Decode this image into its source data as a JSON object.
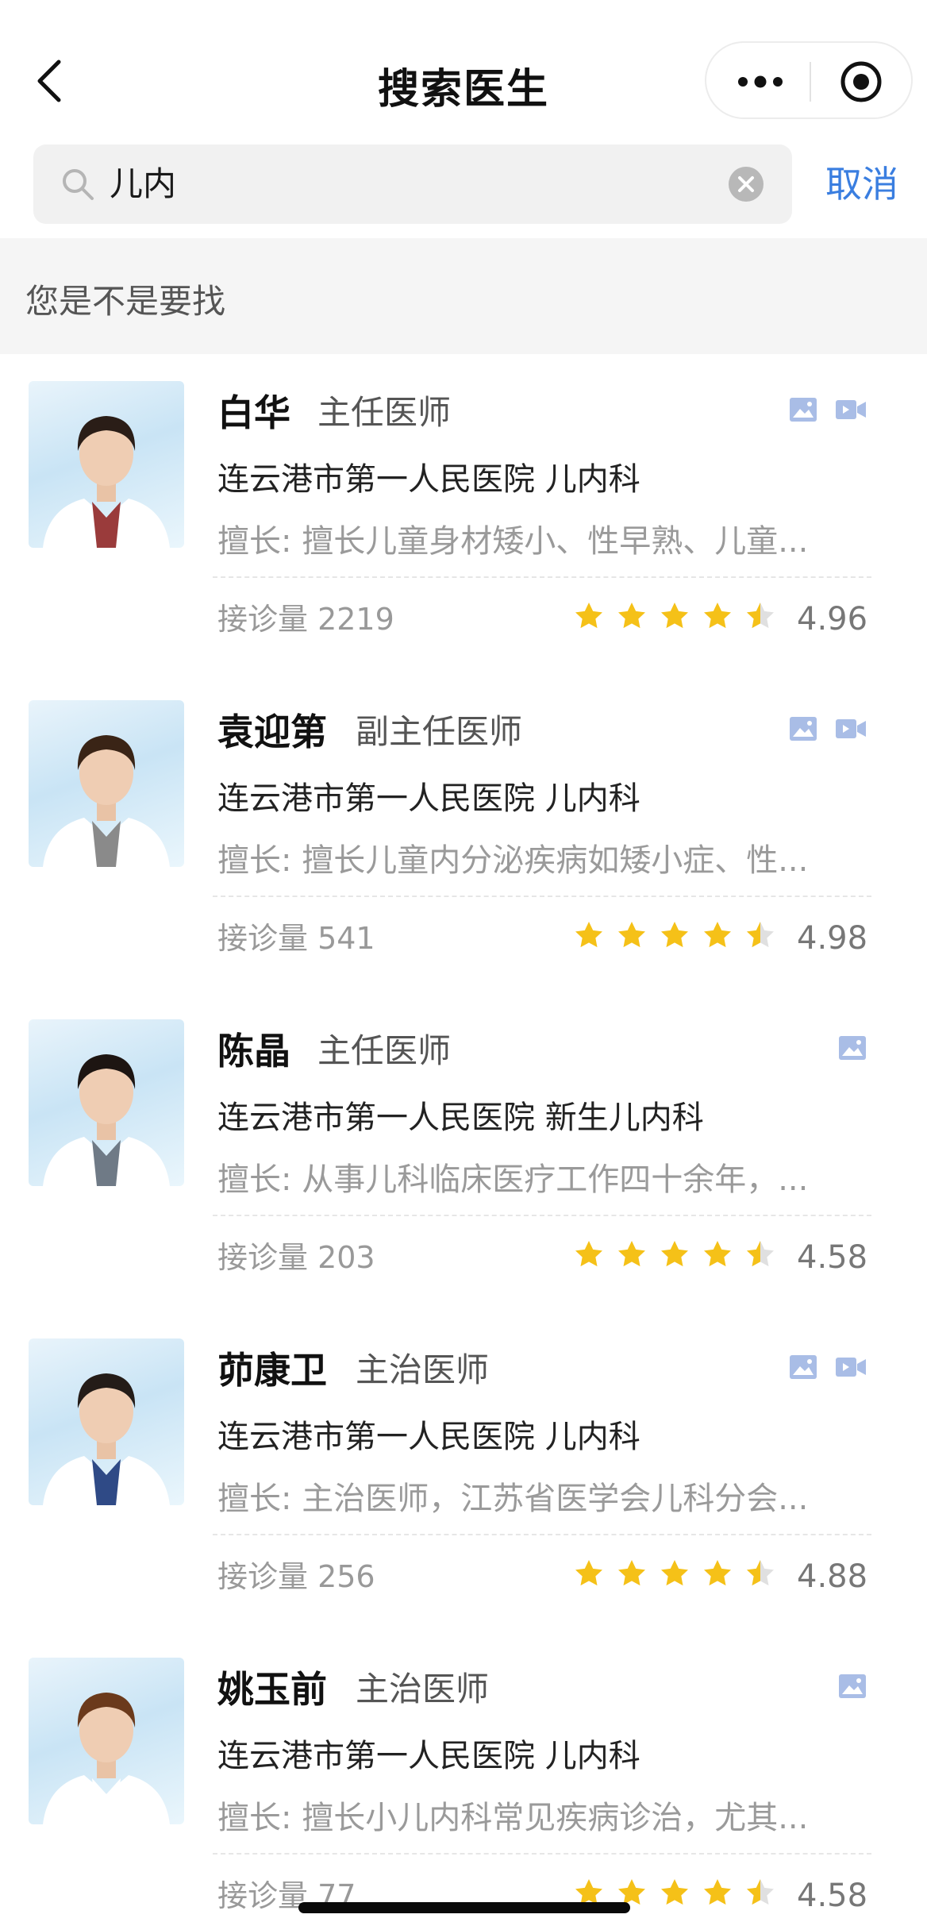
{
  "nav": {
    "title": "搜索医生",
    "back_icon": "chevron-left-icon",
    "more_icon": "more-dots-icon",
    "close_icon": "target-circle-icon"
  },
  "search": {
    "value": "儿内",
    "cancel_label": "取消"
  },
  "section": {
    "header": "您是不是要找"
  },
  "colors": {
    "accent": "#3a7ee0",
    "star": "#f5c118",
    "star_empty": "#e0e0e0",
    "media_icon": "#a9bde6"
  },
  "doctors": [
    {
      "name": "白华",
      "title": "主任医师",
      "hospital": "连云港市第一人民医院 儿内科",
      "specialty": "擅长: 擅长儿童身材矮小、性早熟、儿童...",
      "visits": "接诊量 2219",
      "rating": "4.96",
      "has_image_consult": true,
      "has_video_consult": true
    },
    {
      "name": "袁迎第",
      "title": "副主任医师",
      "hospital": "连云港市第一人民医院 儿内科",
      "specialty": "擅长: 擅长儿童内分泌疾病如矮小症、性...",
      "visits": "接诊量 541",
      "rating": "4.98",
      "has_image_consult": true,
      "has_video_consult": true
    },
    {
      "name": "陈晶",
      "title": "主任医师",
      "hospital": "连云港市第一人民医院 新生儿内科",
      "specialty": "擅长: 从事儿科临床医疗工作四十余年，...",
      "visits": "接诊量 203",
      "rating": "4.58",
      "has_image_consult": true,
      "has_video_consult": false
    },
    {
      "name": "茆康卫",
      "title": "主治医师",
      "hospital": "连云港市第一人民医院 儿内科",
      "specialty": "擅长: 主治医师，江苏省医学会儿科分会...",
      "visits": "接诊量 256",
      "rating": "4.88",
      "has_image_consult": true,
      "has_video_consult": true
    },
    {
      "name": "姚玉前",
      "title": "主治医师",
      "hospital": "连云港市第一人民医院 儿内科",
      "specialty": "擅长: 擅长小儿内科常见疾病诊治，尤其...",
      "visits": "接诊量 77",
      "rating": "4.58",
      "has_image_consult": true,
      "has_video_consult": false
    }
  ]
}
